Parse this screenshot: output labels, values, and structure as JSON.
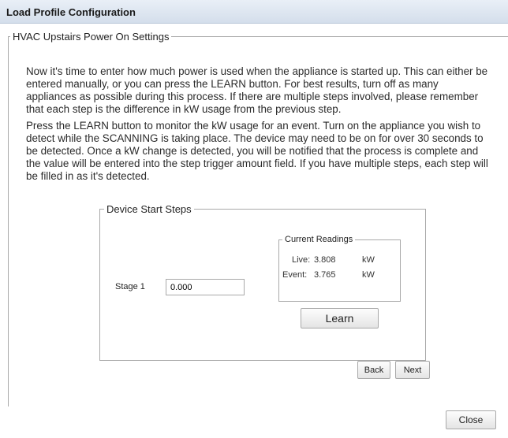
{
  "window": {
    "title": "Load Profile Configuration"
  },
  "section": {
    "legend": "HVAC Upstairs Power On Settings",
    "paragraph1": "Now it's time to enter how much power is used when the appliance is started up. This can either be entered manually, or you can press the LEARN button. For best results, turn off as many appliances as possible during this process. If there are multiple steps involved, please remember that each step is the difference in kW usage from the previous step.",
    "paragraph2": "Press the LEARN button to monitor the kW usage for an event. Turn on the appliance you wish to detect while the SCANNING is taking place. The device may need to be on for over 30 seconds to be detected. Once a kW change is detected, you will be notified that the process is complete and the value will be entered into the step trigger amount field. If you have multiple steps, each step will be filled in as it's detected."
  },
  "steps": {
    "legend": "Device Start Steps",
    "stage_label": "Stage 1",
    "stage_value": "0.000"
  },
  "readings": {
    "legend": "Current Readings",
    "live_label": "Live:",
    "live_value": "3.808",
    "live_unit": "kW",
    "event_label": "Event:",
    "event_value": "3.765",
    "event_unit": "kW"
  },
  "buttons": {
    "learn": "Learn",
    "back": "Back",
    "next": "Next",
    "close": "Close"
  }
}
